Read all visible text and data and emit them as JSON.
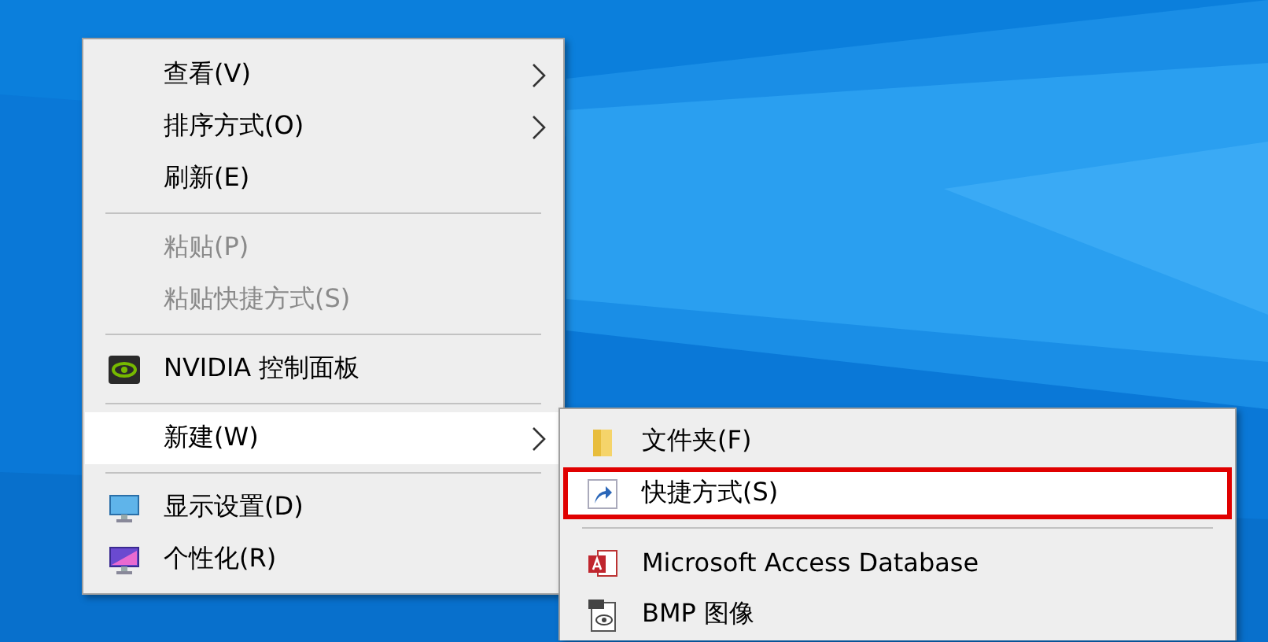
{
  "context_menu": {
    "items": [
      {
        "kind": "item",
        "label": "查看(V)",
        "disabled": false,
        "selected": false,
        "submenu": true
      },
      {
        "kind": "item",
        "label": "排序方式(O)",
        "disabled": false,
        "selected": false,
        "submenu": true
      },
      {
        "kind": "item",
        "label": "刷新(E)",
        "disabled": false,
        "selected": false,
        "submenu": false
      },
      {
        "kind": "separator"
      },
      {
        "kind": "item",
        "label": "粘贴(P)",
        "disabled": true,
        "selected": false,
        "submenu": false
      },
      {
        "kind": "item",
        "label": "粘贴快捷方式(S)",
        "disabled": true,
        "selected": false,
        "submenu": false
      },
      {
        "kind": "separator"
      },
      {
        "kind": "item",
        "label": "NVIDIA 控制面板",
        "disabled": false,
        "selected": false,
        "submenu": false
      },
      {
        "kind": "separator"
      },
      {
        "kind": "item",
        "label": "新建(W)",
        "disabled": false,
        "selected": true,
        "submenu": true
      },
      {
        "kind": "separator"
      },
      {
        "kind": "item",
        "label": "显示设置(D)",
        "disabled": false,
        "selected": false,
        "submenu": false
      },
      {
        "kind": "item",
        "label": "个性化(R)",
        "disabled": false,
        "selected": false,
        "submenu": false
      }
    ]
  },
  "new_submenu": {
    "items": [
      {
        "kind": "item",
        "label": "文件夹(F)",
        "highlighted": false
      },
      {
        "kind": "item",
        "label": "快捷方式(S)",
        "highlighted": true
      },
      {
        "kind": "separator"
      },
      {
        "kind": "item",
        "label": "Microsoft Access Database",
        "highlighted": false
      },
      {
        "kind": "item",
        "label": "BMP 图像",
        "highlighted": false
      }
    ]
  }
}
